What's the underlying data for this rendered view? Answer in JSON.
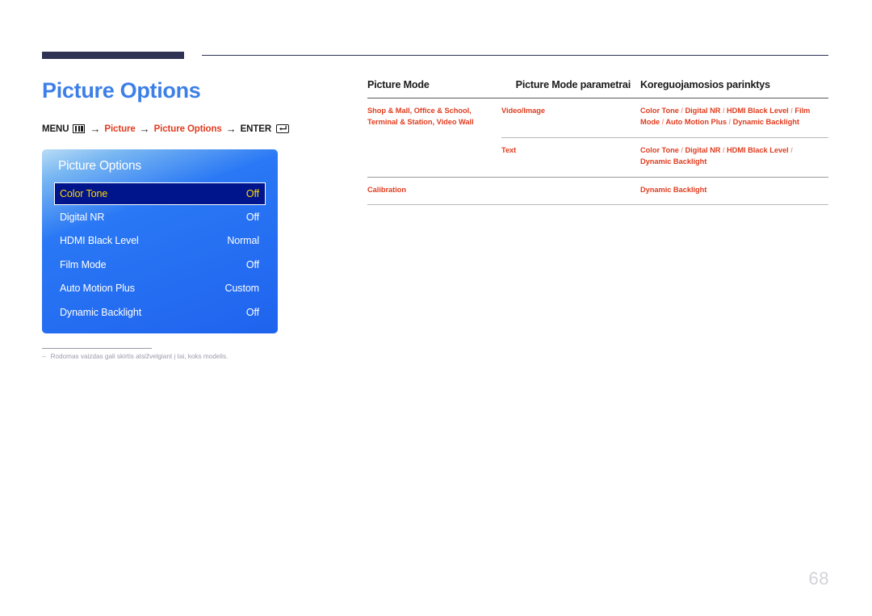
{
  "page": {
    "title": "Picture Options",
    "number": "68",
    "title_color": "#3d7fe8",
    "accent_red": "#e03c1f",
    "rule_color": "#2e3253"
  },
  "breadcrumb": {
    "menu_label": "MENU",
    "menu_icon": "menu-grid-icon",
    "arrow": "→",
    "step1": "Picture",
    "step2": "Picture Options",
    "enter_label": "ENTER",
    "enter_icon": "enter-return-icon"
  },
  "osd": {
    "title": "Picture Options",
    "selected_index": 0,
    "rows": [
      {
        "label": "Color Tone",
        "value": "Off"
      },
      {
        "label": "Digital NR",
        "value": "Off"
      },
      {
        "label": "HDMI Black Level",
        "value": "Normal"
      },
      {
        "label": "Film Mode",
        "value": "Off"
      },
      {
        "label": "Auto Motion Plus",
        "value": "Custom"
      },
      {
        "label": "Dynamic Backlight",
        "value": "Off"
      }
    ],
    "colors": {
      "selected_bg": "#00148c",
      "selected_text": "#ffd800",
      "text": "#ffffff"
    }
  },
  "footnote": {
    "dash": "–",
    "text": "Rodomas vaizdas gali skirtis atsižvelgiant į tai, koks modelis."
  },
  "table": {
    "headers": {
      "col1": "Picture Mode",
      "col2": "Picture Mode parametrai",
      "col3": "Koreguojamosios parinktys"
    },
    "rows": [
      {
        "mode": "Shop & Mall, Office & School, Terminal & Station, Video Wall",
        "param": "Video/Image",
        "options": "Color Tone / Digital NR / HDMI Black Level / Film Mode / Auto Motion Plus / Dynamic Backlight"
      },
      {
        "mode": "",
        "param": "Text",
        "options": "Color Tone / Digital NR / HDMI Black Level / Dynamic Backlight"
      },
      {
        "mode": "Calibration",
        "param": "",
        "options": "Dynamic Backlight"
      }
    ]
  }
}
